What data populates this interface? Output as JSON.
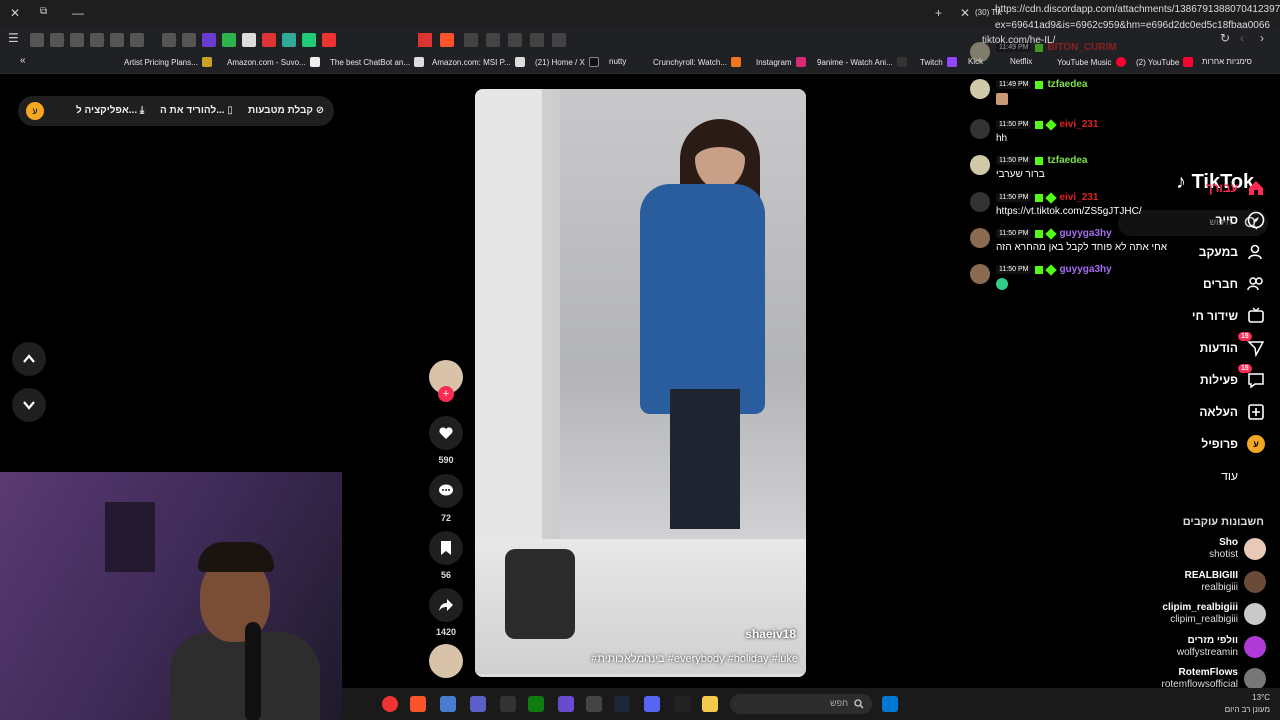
{
  "browser": {
    "url_overlay_line1": "https://cdn.discordapp.com/attachments/1386791388070412397",
    "url_overlay_line2": "ex=69641ad9&is=6962c959&hm=e696d2dc0ed5c18fbaa0066",
    "page_url": "tiktok.com/he-IL/",
    "tab_label": "(30) Tik",
    "bookmarks": [
      "Artist Pricing Plans...",
      "Amazon.com - Suvo...",
      "The best ChatBot an...",
      "Amazon.com: MSI P...",
      "(21) Home / X",
      "nutty",
      "Crunchyroll: Watch...",
      "Instagram",
      "9anime - Watch Ani...",
      "Twitch",
      "Kick",
      "Netflix",
      "YouTube Music",
      "(2) YouTube",
      "סימניות אחרות"
    ]
  },
  "promo": {
    "avatar_letter": "ע",
    "install_app": "אפליקציה ל...",
    "download": "להוריד את ה...",
    "coins": "קבלת מטבעות"
  },
  "video": {
    "username": "shaeiv18",
    "caption": "#בינהמלאכותית #everybody #holiday #luke"
  },
  "actions": {
    "likes": "590",
    "comments": "72",
    "saves": "56",
    "shares": "1420"
  },
  "sidebar": {
    "logo": "TikTok",
    "search_placeholder": "חיפוש",
    "nav": [
      {
        "label": "עבורך",
        "active": true
      },
      {
        "label": "סייר"
      },
      {
        "label": "במעקב"
      },
      {
        "label": "חברים"
      },
      {
        "label": "שידור חי"
      },
      {
        "label": "הודעות",
        "badge": "15"
      },
      {
        "label": "פעילות",
        "badge": "15"
      },
      {
        "label": "העלאה"
      },
      {
        "label": "פרופיל"
      },
      {
        "label": "עוד"
      }
    ],
    "following_title": "חשבונות עוקבים",
    "following": [
      {
        "name": "Sho",
        "handle": "shotist"
      },
      {
        "name": "REALBIGIII",
        "handle": "realbigiii"
      },
      {
        "name": "clipim_realbigiii",
        "handle": "clipim_realbigiii"
      },
      {
        "name": "וולפי מזרים",
        "handle": "wolfystreamin"
      },
      {
        "name": "RotemFlows",
        "handle": "rotemflowsofficial"
      }
    ]
  },
  "chat": [
    {
      "time": "11:49 PM",
      "name": "BITON_CURIM",
      "msg": "",
      "color": "#e02020"
    },
    {
      "time": "11:49 PM",
      "name": "tzfaedea",
      "msg": "",
      "color": "#7ee04a"
    },
    {
      "time": "11:50 PM",
      "name": "eivi_231",
      "msg": "hh",
      "color": "#e02020"
    },
    {
      "time": "11:50 PM",
      "name": "tzfaedea",
      "msg": "ברור שערבי",
      "color": "#7ee04a"
    },
    {
      "time": "11:50 PM",
      "name": "eivi_231",
      "msg": "https://vt.tiktok.com/ZS5gJTJHC/",
      "color": "#e02020"
    },
    {
      "time": "11:50 PM",
      "name": "guyyga3hy",
      "msg": "אחי אתה לא פוחד לקבל באן מהחרא הזה",
      "color": "#a66cf0"
    },
    {
      "time": "11:50 PM",
      "name": "guyyga3hy",
      "msg": "",
      "color": "#a66cf0"
    }
  ],
  "taskbar": {
    "search_placeholder": "חפש",
    "temperature": "13°C",
    "weather": "מעונן רב היום"
  }
}
